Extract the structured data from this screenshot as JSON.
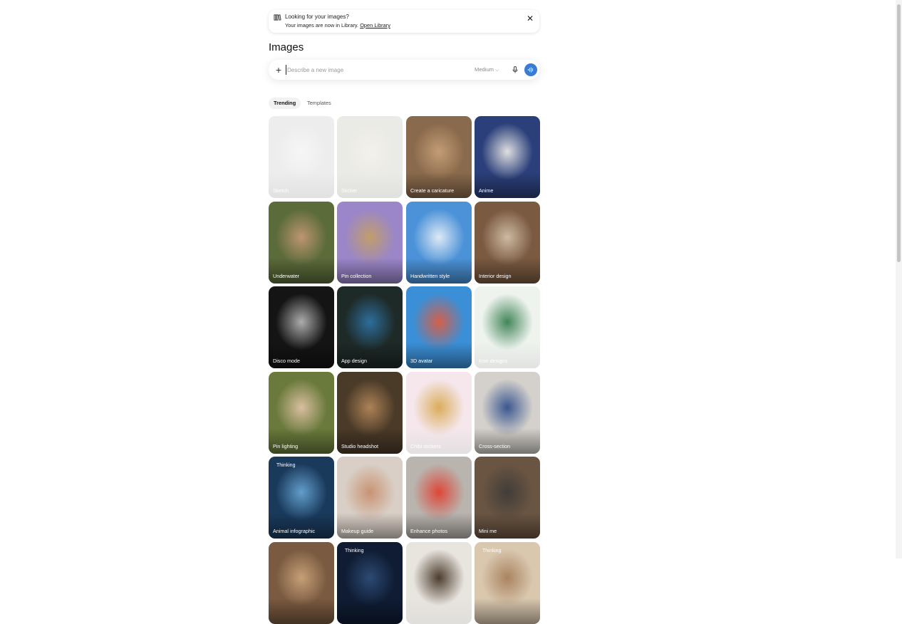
{
  "banner": {
    "title": "Looking for your images?",
    "message": "Your images are now in Library.",
    "link_label": "Open Library",
    "icon": "library-icon",
    "close_icon": "close-icon"
  },
  "page_title": "Images",
  "composer": {
    "placeholder": "Describe a new image",
    "quality": "Medium",
    "plus_icon": "plus-icon",
    "mic_icon": "microphone-icon",
    "voice_icon": "voice-mode-icon",
    "accent": "#3a7bd5"
  },
  "tabs": [
    {
      "label": "Trending",
      "active": true
    },
    {
      "label": "Templates",
      "active": false
    }
  ],
  "cards": [
    {
      "label": "Sketch",
      "bg": "#ededed",
      "accent": "#f7f7f7",
      "light": true
    },
    {
      "label": "Sticker",
      "bg": "#eaeae6",
      "accent": "#f4f2ec",
      "light": true
    },
    {
      "label": "Create a caricature",
      "bg": "#8a6a4c",
      "accent": "#c9a27a",
      "light": false
    },
    {
      "label": "Anime",
      "bg": "#2b3f7a",
      "accent": "#f3f1ec",
      "light": false
    },
    {
      "label": "Underwater",
      "bg": "#5b6b3a",
      "accent": "#c89a78",
      "light": false
    },
    {
      "label": "Pin collection",
      "bg": "#9a86c9",
      "accent": "#c6a060",
      "light": false
    },
    {
      "label": "Handwritten style",
      "bg": "#4b92d8",
      "accent": "#eef3f8",
      "light": false
    },
    {
      "label": "Interior design",
      "bg": "#7a5a40",
      "accent": "#d7c4ad",
      "light": false
    },
    {
      "label": "Disco mode",
      "bg": "#141414",
      "accent": "#bdbdbd",
      "light": false
    },
    {
      "label": "App design",
      "bg": "#1e2a28",
      "accent": "#2f76a8",
      "light": false
    },
    {
      "label": "3D avatar",
      "bg": "#3b8fd6",
      "accent": "#e65a3a",
      "light": false
    },
    {
      "label": "Icon designs",
      "bg": "#eef3ee",
      "accent": "#2f7a48",
      "light": true
    },
    {
      "label": "Pin lighting",
      "bg": "#6a7a3c",
      "accent": "#e6c6aa",
      "light": false
    },
    {
      "label": "Studio headshot",
      "bg": "#4a3a28",
      "accent": "#b88a5c",
      "light": false
    },
    {
      "label": "Chibi stickers",
      "bg": "#f5e7ec",
      "accent": "#d8a64c",
      "light": true
    },
    {
      "label": "Cross-section",
      "bg": "#d4d0cb",
      "accent": "#2a4a8a",
      "light": false
    },
    {
      "label": "Animal infographic",
      "bg": "#1a3a5c",
      "accent": "#6aa9d8",
      "light": false,
      "badge": "Thinking"
    },
    {
      "label": "Makeup guide",
      "bg": "#d9cfc6",
      "accent": "#c78c6a",
      "light": false
    },
    {
      "label": "Enhance photos",
      "bg": "#b9b4ae",
      "accent": "#e23a2a",
      "light": false
    },
    {
      "label": "Mini me",
      "bg": "#6a5542",
      "accent": "#3c3a38",
      "light": false
    },
    {
      "label": "",
      "bg": "#7a5a40",
      "accent": "#cfa77e",
      "light": false
    },
    {
      "label": "",
      "bg": "#0f1c33",
      "accent": "#2f4f7a",
      "light": false,
      "badge": "Thinking"
    },
    {
      "label": "",
      "bg": "#e8e4de",
      "accent": "#3a2a1a",
      "light": true
    },
    {
      "label": "",
      "bg": "#d9c7ae",
      "accent": "#a47c58",
      "light": false,
      "badge": "Thinking"
    }
  ]
}
